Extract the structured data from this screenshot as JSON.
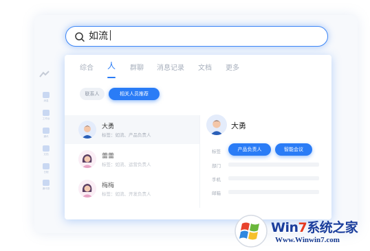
{
  "search": {
    "query": "如流"
  },
  "tabs": [
    {
      "label": "综合"
    },
    {
      "label": "人"
    },
    {
      "label": "群聊"
    },
    {
      "label": "消息记录"
    },
    {
      "label": "文档"
    },
    {
      "label": "更多"
    }
  ],
  "filters": [
    {
      "label": "联系人"
    },
    {
      "label": "相关人员推荐"
    }
  ],
  "results": [
    {
      "name": "大勇",
      "subtitle": "标签：如流、产品负责人"
    },
    {
      "name": "蕾蕾",
      "subtitle": "标签：如流、运营负责人"
    },
    {
      "name": "梅梅",
      "subtitle": "标签：如流、开发负责人"
    }
  ],
  "detail": {
    "name": "大勇",
    "tags": [
      "产品负责人",
      "智能会议"
    ],
    "fields": [
      {
        "label": "标签"
      },
      {
        "label": "部门"
      },
      {
        "label": "手机"
      },
      {
        "label": "邮箱"
      }
    ]
  },
  "sidebar": [
    {
      "label": "消息"
    },
    {
      "label": "工作台"
    },
    {
      "label": "通讯"
    },
    {
      "label": "文档"
    },
    {
      "label": "日程"
    },
    {
      "label": "通讯录"
    }
  ],
  "watermark": {
    "brand_prefix": "Win",
    "brand_seven": "7",
    "brand_suffix": "系统之家",
    "url": "Www.Winwin7.com"
  },
  "colors": {
    "accent": "#2a7cf6",
    "panel_bg": "#ffffff"
  }
}
